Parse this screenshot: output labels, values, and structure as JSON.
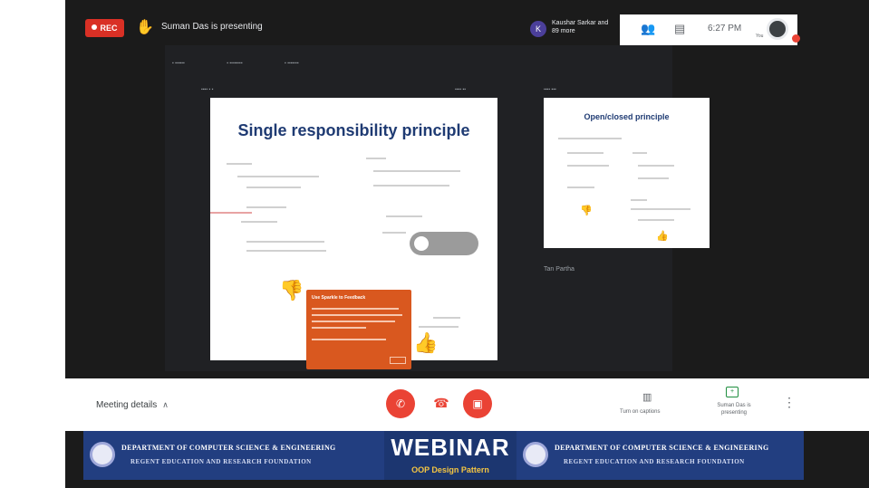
{
  "topbar": {
    "rec_label": "REC",
    "presenter_text": "Suman Das is presenting",
    "participant_avatar": "K",
    "participants_text": "Kaushar Sarkar and 89 more",
    "time": "6:27 PM",
    "you_label": "You"
  },
  "presentation": {
    "slide_title": "Single responsibility principle",
    "side_slide_title": "Open/closed principle",
    "side_caption": "Tan Partha",
    "popup_title": "Use Sparkle to Feedback"
  },
  "meetbar": {
    "details_label": "Meeting details",
    "captions_label": "Turn on captions",
    "presenting_label": "Suman Das is presenting"
  },
  "banner": {
    "dept_left": "DEPARTMENT OF COMPUTER SCIENCE & ENGINEERING",
    "foundation_left": "REGENT EDUCATION AND RESEARCH FOUNDATION",
    "webinar": "WEBINAR",
    "subtitle": "OOP Design Pattern",
    "dept_right": "DEPARTMENT OF COMPUTER SCIENCE & ENGINEERING",
    "foundation_right": "REGENT EDUCATION AND RESEARCH FOUNDATION"
  },
  "colors": {
    "accent_red": "#ea4335",
    "banner_blue": "#223e80",
    "slide_title_blue": "#1f3b73"
  },
  "icons": [
    "presenter-icon",
    "people-icon",
    "chat-icon",
    "mic-off-icon",
    "hang-up-icon",
    "camera-off-icon",
    "captions-icon",
    "present-screen-icon",
    "more-options-icon",
    "thumbs-down-icon",
    "thumbs-up-icon"
  ]
}
